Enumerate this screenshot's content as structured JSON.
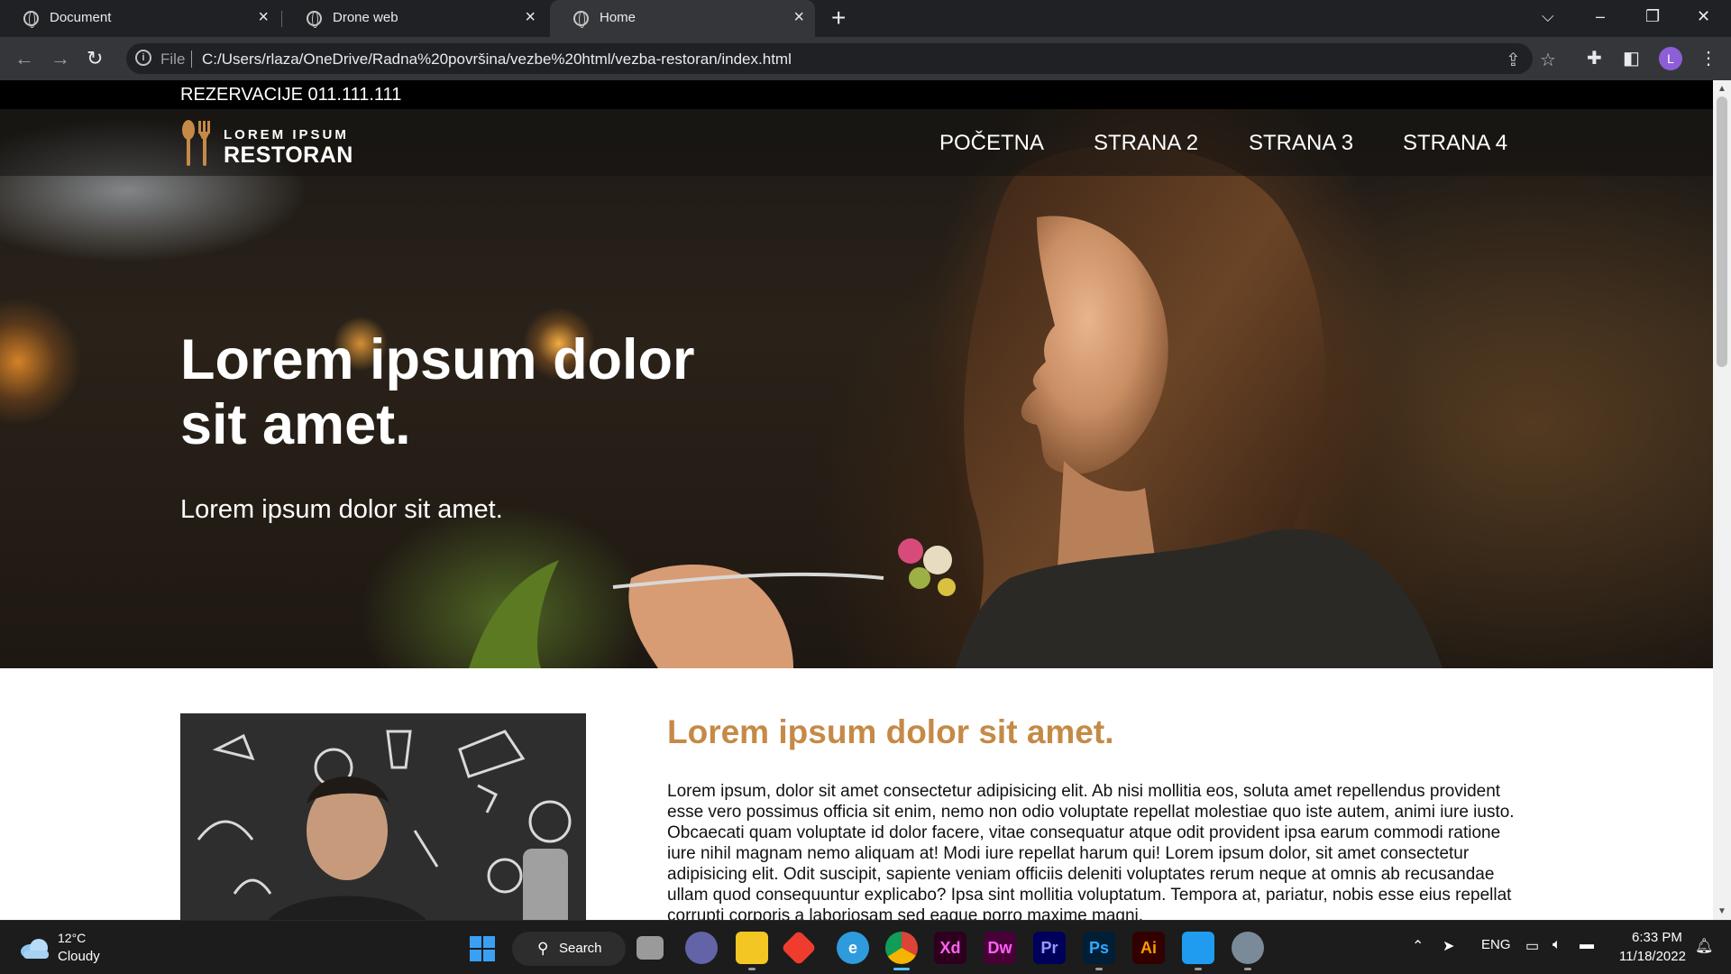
{
  "browser": {
    "tabs": [
      {
        "title": "Document",
        "active": false
      },
      {
        "title": "Drone web",
        "active": false
      },
      {
        "title": "Home",
        "active": true
      }
    ],
    "new_tab_icon": "plus-icon",
    "address": {
      "scheme_label": "File",
      "url": "C:/Users/rlaza/OneDrive/Radna%20površina/vezbe%20html/vezba-restoran/index.html"
    },
    "profile_initial": "L"
  },
  "page": {
    "topbar": {
      "text": "REZERVACIJE 011.111.111"
    },
    "logo": {
      "top": "LOREM IPSUM",
      "bottom": "RESTORAN"
    },
    "nav": [
      "POČETNA",
      "STRANA 2",
      "STRANA 3",
      "STRANA 4"
    ],
    "hero": {
      "title": "Lorem ipsum dolor sit amet.",
      "subtitle": "Lorem ipsum dolor sit amet."
    },
    "about": {
      "title": "Lorem ipsum dolor sit amet.",
      "text": "Lorem ipsum, dolor sit amet consectetur adipisicing elit. Ab nisi mollitia eos, soluta amet repellendus provident esse vero possimus officia sit enim, nemo non odio voluptate repellat molestiae quo iste autem, animi iure iusto. Obcaecati quam voluptate id dolor facere, vitae consequatur atque odit provident ipsa earum commodi ratione iure nihil magnam nemo aliquam at! Modi iure repellat harum qui! Lorem ipsum dolor, sit amet consectetur adipisicing elit. Odit suscipit, sapiente veniam officiis deleniti voluptates rerum neque at omnis ab recusandae ullam quod consequuntur explicabo? Ipsa sint mollitia voluptatum. Tempora at, pariatur, nobis esse eius repellat corrupti corporis a laboriosam sed eaque porro maxime magni."
    },
    "colors": {
      "accent": "#c58a47",
      "topbar": "#000000"
    }
  },
  "taskbar": {
    "weather": {
      "temp": "12°C",
      "desc": "Cloudy"
    },
    "search_label": "Search",
    "apps": [
      {
        "name": "start",
        "label": ""
      },
      {
        "name": "task-view",
        "label": ""
      },
      {
        "name": "teams-chat",
        "label": ""
      },
      {
        "name": "file-explorer",
        "label": ""
      },
      {
        "name": "git-app",
        "label": ""
      },
      {
        "name": "edge",
        "label": ""
      },
      {
        "name": "chrome",
        "label": ""
      },
      {
        "name": "adobe-xd",
        "label": "Xd"
      },
      {
        "name": "dreamweaver",
        "label": "Dw"
      },
      {
        "name": "premiere",
        "label": "Pr"
      },
      {
        "name": "photoshop",
        "label": "Ps"
      },
      {
        "name": "illustrator",
        "label": "Ai"
      },
      {
        "name": "vscode",
        "label": ""
      },
      {
        "name": "settings",
        "label": ""
      }
    ],
    "language": "ENG",
    "time": "6:33 PM",
    "date": "11/18/2022"
  }
}
